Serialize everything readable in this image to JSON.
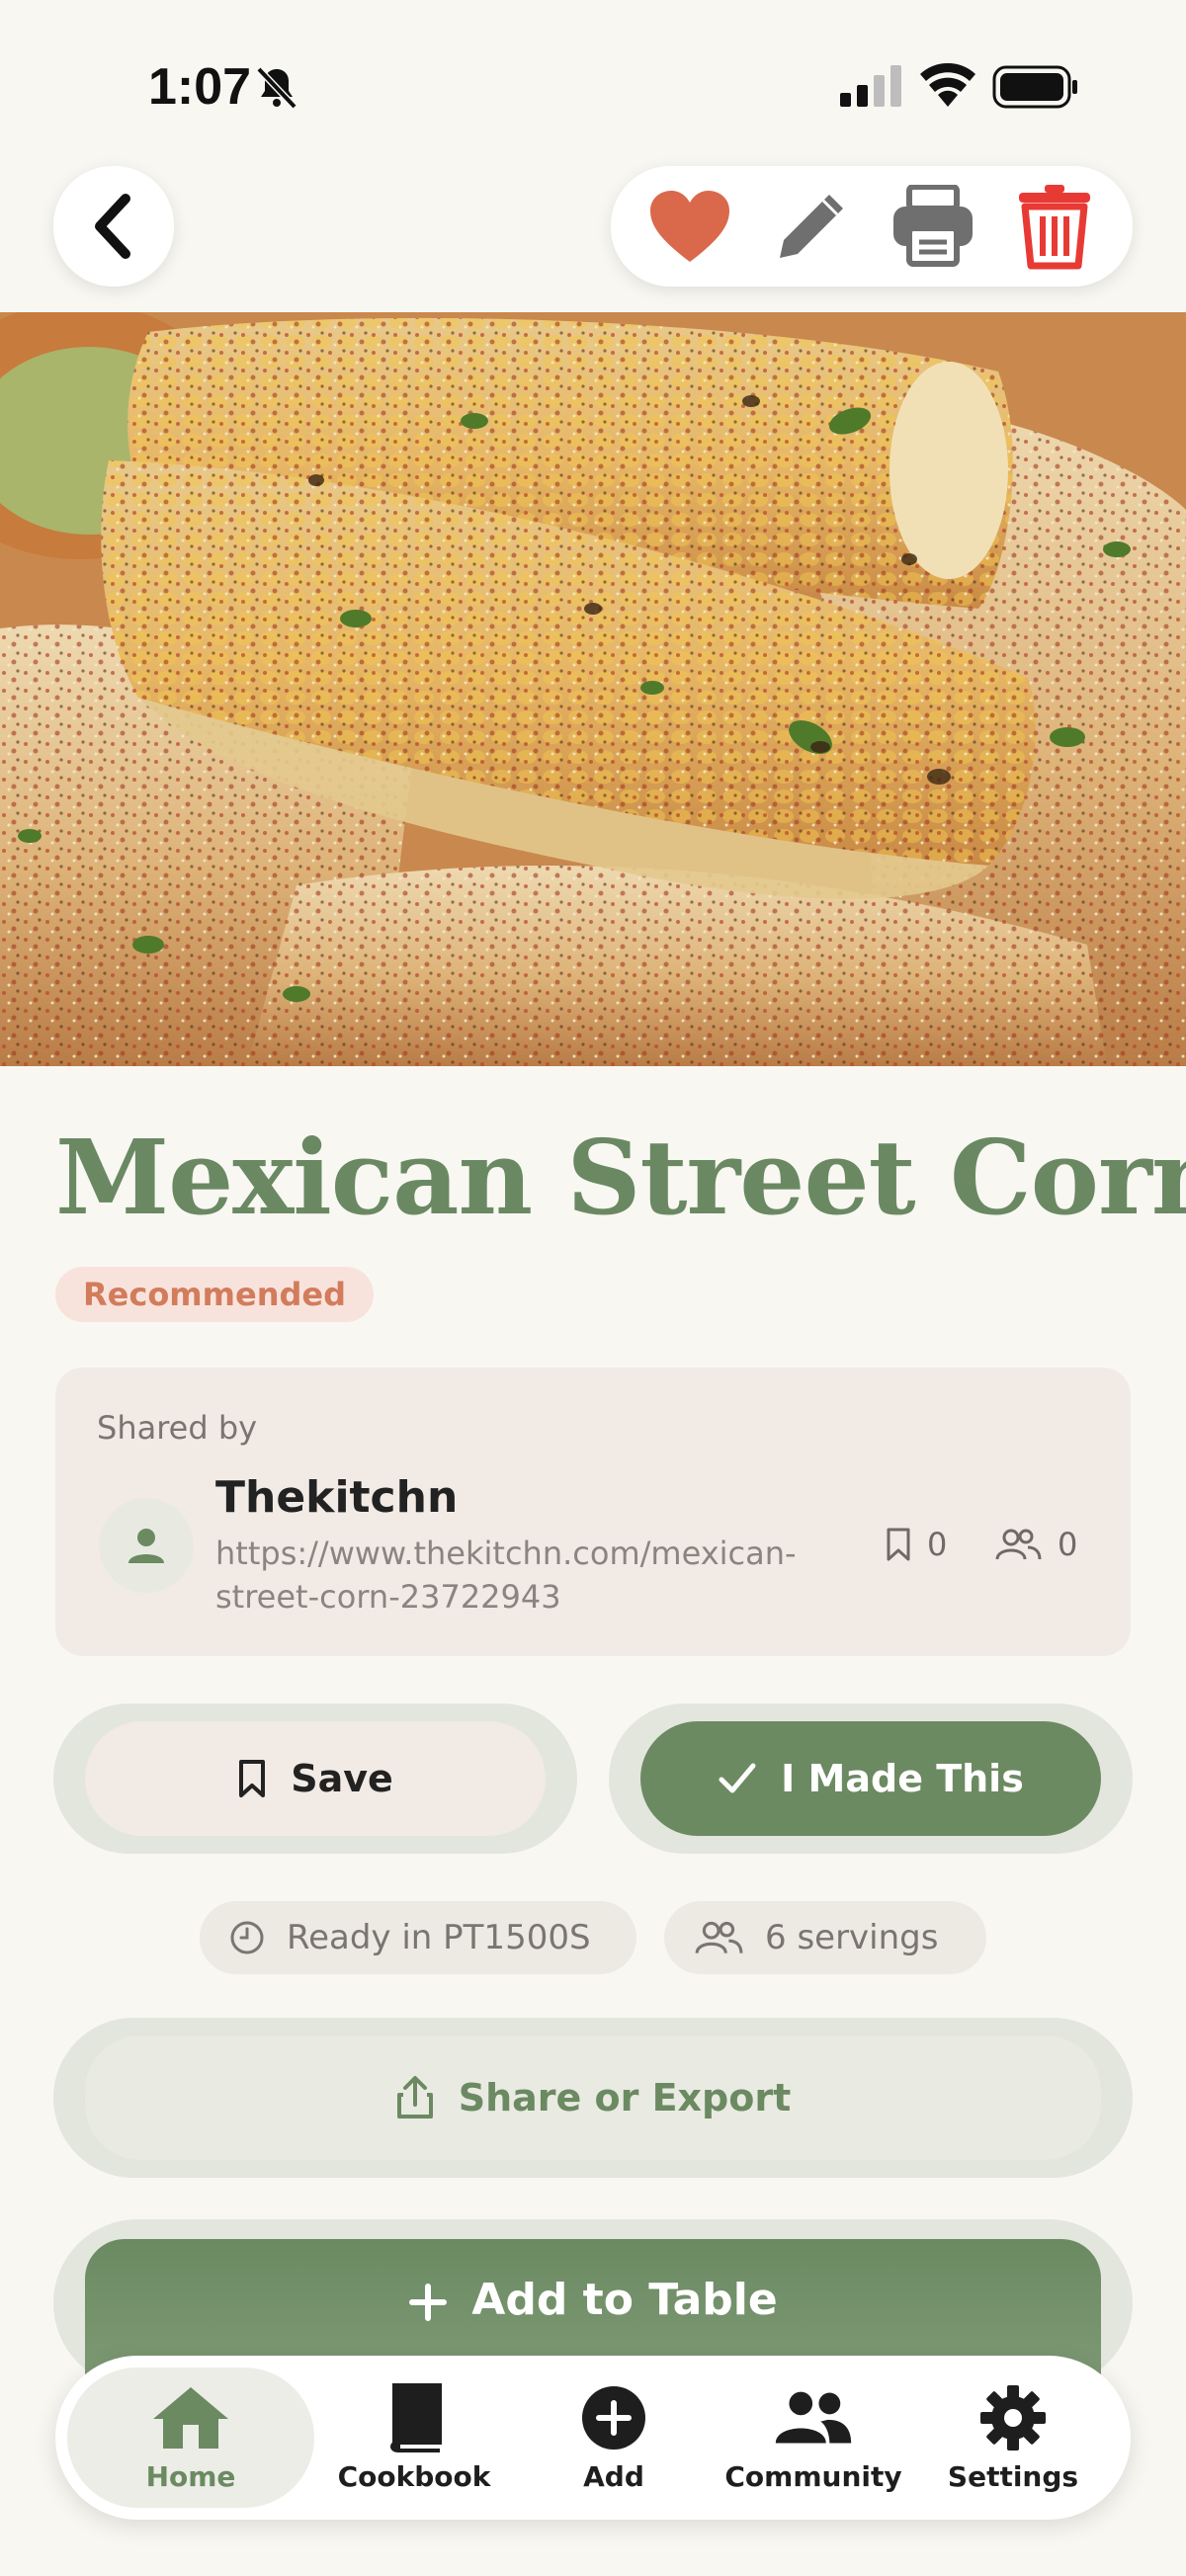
{
  "status_bar": {
    "time": "1:07"
  },
  "nav": {
    "back_icon": "chevron-left-icon",
    "actions": [
      {
        "name": "favorite",
        "icon": "heart-icon",
        "color": "#D9694A"
      },
      {
        "name": "edit",
        "icon": "pencil-icon",
        "color": "#6F6F6F"
      },
      {
        "name": "print",
        "icon": "printer-icon",
        "color": "#6F6F6F"
      },
      {
        "name": "delete",
        "icon": "trash-icon",
        "color": "#E83A34"
      }
    ]
  },
  "recipe": {
    "title": "Mexican Street Corn",
    "badge": "Recommended"
  },
  "shared": {
    "label": "Shared by",
    "author": "Thekitchn",
    "url": "https://www.thekitchn.com/mexican-street-corn-23722943",
    "saves": "0",
    "people": "0"
  },
  "actions": {
    "save_label": "Save",
    "made_label": "I Made This"
  },
  "info": {
    "ready": "Ready in PT1500S",
    "servings": "6 servings"
  },
  "share": {
    "label": "Share or Export"
  },
  "add_table": {
    "label": "Add to Table"
  },
  "tabs": [
    {
      "label": "Home",
      "icon": "home-icon",
      "active": true
    },
    {
      "label": "Cookbook",
      "icon": "book-icon",
      "active": false
    },
    {
      "label": "Add",
      "icon": "plus-circle-icon",
      "active": false
    },
    {
      "label": "Community",
      "icon": "people-icon",
      "active": false
    },
    {
      "label": "Settings",
      "icon": "gear-icon",
      "active": false
    }
  ],
  "colors": {
    "accent_green": "#6B8A62",
    "badge_text": "#D27C5C",
    "background": "#F9F7F2"
  }
}
